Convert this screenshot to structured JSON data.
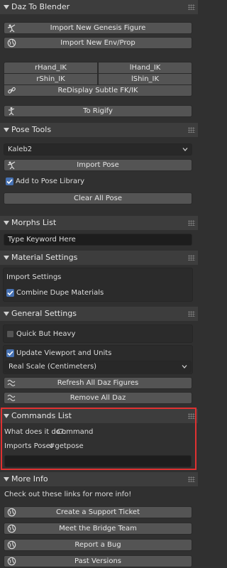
{
  "daz_to_blender": {
    "title": "Daz To Blender",
    "import_genesis": "Import New Genesis Figure",
    "import_env": "Import New Env/Prop",
    "rhand_ik": "rHand_IK",
    "lhand_ik": "lHand_IK",
    "rshin_ik": "rShin_IK",
    "lshin_ik": "lShin_IK",
    "redisplay": "ReDisplay Subtle FK/IK",
    "to_rigify": "To Rigify"
  },
  "pose_tools": {
    "title": "Pose Tools",
    "selected_figure": "Kaleb2",
    "import_pose": "Import Pose",
    "add_to_library": "Add to Pose Library",
    "add_to_library_checked": true,
    "clear_all_pose": "Clear All Pose"
  },
  "morphs_list": {
    "title": "Morphs List",
    "search_placeholder": "Type Keyword Here"
  },
  "material_settings": {
    "title": "Material Settings",
    "import_settings": "Import Settings",
    "combine_dupe": "Combine Dupe Materials",
    "combine_dupe_checked": true
  },
  "general_settings": {
    "title": "General Settings",
    "quick_but_heavy": "Quick But Heavy",
    "quick_but_heavy_checked": false,
    "update_viewport": "Update Viewport and Units",
    "update_viewport_checked": true,
    "scale_option": "Real Scale (Centimeters)",
    "refresh_all": "Refresh All Daz Figures",
    "remove_all": "Remove All Daz"
  },
  "commands_list": {
    "title": "Commands List",
    "what_does_label": "What does it do?:",
    "what_does_value": "Command",
    "imports_pose_label": "Imports Pose:",
    "imports_pose_value": "#getpose",
    "command_input_value": ""
  },
  "more_info": {
    "title": "More Info",
    "description": "Check out these links for more info!",
    "support_ticket": "Create a Support Ticket",
    "meet_team": "Meet the Bridge Team",
    "report_bug": "Report a Bug",
    "past_versions": "Past Versions"
  },
  "colors": {
    "panel_bg": "#303030",
    "header_bg": "#3d3d3d",
    "button_bg": "#545454",
    "checkbox_accent": "#4772b3",
    "highlight": "#e03131"
  }
}
